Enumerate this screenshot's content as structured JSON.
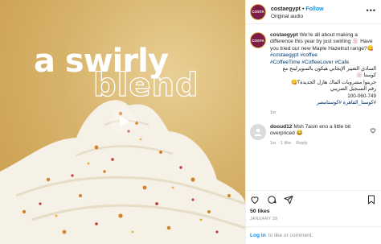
{
  "header": {
    "avatar_text": "COSTA",
    "username": "costaegypt",
    "follow_label": "Follow",
    "audio_label": "Original audio",
    "more_label": "•••"
  },
  "media": {
    "headline_line1": "a swirly",
    "headline_line2": "blend"
  },
  "caption": {
    "username": "costaegypt",
    "text": "We're all about making a difference this year by just swirling 🍥 Have you tried our new Maple Hazelnut range?😋",
    "hashtags_line1": "#costaegypt #coffee",
    "hashtags_line2": "#CoffeeTime #CoffeeLover #Cafe",
    "arabic_line1": "السادي التغيير الإيجابي هيكون بالسويرلينج مع كوستا 🍥",
    "arabic_line2": "جربتوا مشروبات الماك هازل الجديدة؟😋",
    "arabic_line3": "رقم التسجيل الضريبي",
    "phone": "100-060-749",
    "arabic_tags": "#كوستا_القاهرة #كوستامصر",
    "time": "1w"
  },
  "comment": {
    "username": "dooud12",
    "text": "Msh 7asin eno a little bit overpriced 😂",
    "time": "1w",
    "likes": "1 like",
    "reply_label": "Reply"
  },
  "stats": {
    "likes": "50 likes",
    "date": "JANUARY 28"
  },
  "login": {
    "link_label": "Log in",
    "text": "to like or comment."
  },
  "colors": {
    "accent": "#0095f6",
    "hashtag": "#00376b",
    "brand": "#7b1d46"
  }
}
